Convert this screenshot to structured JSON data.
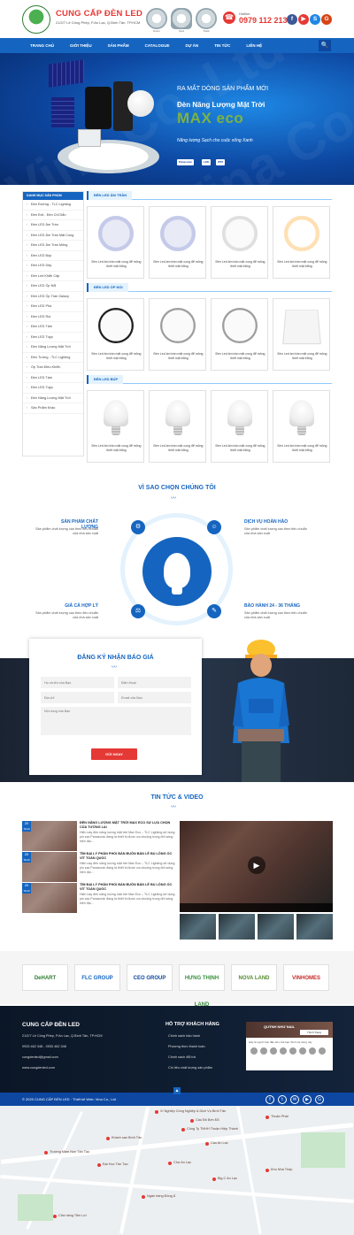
{
  "header": {
    "brand": "CUNG CẤP ĐÈN LED",
    "address": "21/2/7 Lê Công Phép, P.An Lạc, Q.Bình Tân, TP.HCM",
    "bulbs": [
      "Down",
      "Spot",
      "Track"
    ],
    "hotline_label": "Hotline",
    "hotline": "0979 112 213",
    "social": [
      {
        "name": "facebook-icon",
        "glyph": "f",
        "color": "#3b5998"
      },
      {
        "name": "youtube-icon",
        "glyph": "▶",
        "color": "#e53935"
      },
      {
        "name": "skype-icon",
        "glyph": "S",
        "color": "#1e88e5"
      },
      {
        "name": "google-plus-icon",
        "glyph": "G",
        "color": "#d84315"
      }
    ]
  },
  "nav": {
    "items": [
      "TRANG CHỦ",
      "GIỚI THIỆU",
      "SẢN PHẨM",
      "CATALOGUE",
      "DỰ ÁN",
      "TIN TỨC",
      "LIÊN HỆ"
    ],
    "search_icon": "🔍"
  },
  "banner": {
    "subtitle": "RA MẮT DÒNG SẢN PHẨM MỚI",
    "title": "Đèn Năng Lượng Mặt Trời",
    "product": "MAX eco",
    "slogan": "Năng lượng Sạch cho cuộc sống Xanh",
    "badges": [
      "Panasonic",
      "LED",
      "IP67"
    ],
    "watermark": "Vina Co.,Ltd"
  },
  "sidebar": {
    "title": "DANH MỤC SẢN PHẨM",
    "items": [
      "Đèn Đường - TLC Lighting",
      "Đèn Exit - Đèn Chỉ Dẫn",
      "Đèn LED Âm Trần",
      "Đèn LED Âm Trần Mặt Cong",
      "Đèn LED Âm Trần Mỏng",
      "Đèn LED Búp",
      "Đèn LED Dây",
      "Đèn Led Khẩn Cấp",
      "Đèn LED Ốp Nổi",
      "Đèn LED Ốp Trần Galaxy",
      "Đèn LED Pha",
      "Đèn LED Rọi",
      "Đèn LED Tấm",
      "Đèn LED Tuýp",
      "Đèn Năng Lượng Mặt Trời",
      "Đèn Tường - TLC Lighting",
      "Ổp Trần Điều Khiển",
      "Đèn LED Tấm",
      "Đèn LED Tuýp",
      "Đèn Năng Lượng Mặt Trời",
      "Sản Phẩm Khác"
    ]
  },
  "products": {
    "sections": [
      {
        "title": "ĐÈN LED ÂM TRẦN",
        "items": [
          {
            "caption": "Đèn Led âm trần mặt cong để mỏng thiết mặt trắng",
            "img": "i-down"
          },
          {
            "caption": "Đèn Led âm trần mặt cong để mỏng thiết mặt trắng",
            "img": "i-down"
          },
          {
            "caption": "Đèn Led âm trần mặt cong để mỏng thiết mặt trắng",
            "img": "i-down2"
          },
          {
            "caption": "Đèn Led âm trần mặt cong để mỏng thiết mặt trắng",
            "img": "i-down3"
          }
        ]
      },
      {
        "title": "ĐÈN LED ỐP NỔI",
        "items": [
          {
            "caption": "Đèn Led âm trần mặt cong để mỏng thiết mặt trắng",
            "img": "i-round-b"
          },
          {
            "caption": "Đèn Led âm trần mặt cong để mỏng thiết mặt trắng",
            "img": "i-round-g"
          },
          {
            "caption": "Đèn Led âm trần mặt cong để mỏng thiết mặt trắng",
            "img": "i-round-g"
          },
          {
            "caption": "Đèn Led âm trần mặt cong để mỏng thiết mặt trắng",
            "img": "i-sq"
          }
        ]
      },
      {
        "title": "ĐÈN LED BÚP",
        "items": [
          {
            "caption": "Đèn Led âm trần mặt cong để mỏng thiết mặt trắng",
            "img": "i-bulb"
          },
          {
            "caption": "Đèn Led âm trần mặt cong để mỏng thiết mặt trắng",
            "img": "i-bulb"
          },
          {
            "caption": "Đèn Led âm trần mặt cong để mỏng thiết mặt trắng",
            "img": "i-bulb"
          },
          {
            "caption": "Đèn Led âm trần mặt cong để mỏng thiết mặt trắng",
            "img": "i-bulb"
          }
        ]
      }
    ]
  },
  "why": {
    "title": "VÌ SAO CHỌN CHÚNG TÔI",
    "wave": "〰",
    "items": [
      {
        "heading": "SẢN PHẨM CHẤT LƯỢNG",
        "desc": "Sản phẩm chất lượng cao theo tiêu chuẩn của nhà sản xuất",
        "icon": "⚙"
      },
      {
        "heading": "DỊCH VỤ HOÀN HẢO",
        "desc": "Sản phẩm chất lượng cao theo tiêu chuẩn của nhà sản xuất",
        "icon": "☺"
      },
      {
        "heading": "GIÁ CẢ HỢP LÝ",
        "desc": "Sản phẩm chất lượng cao theo tiêu chuẩn của nhà sản xuất",
        "icon": "⚖"
      },
      {
        "heading": "BẢO HÀNH 24 - 36 THÁNG",
        "desc": "Sản phẩm chất lượng cao theo tiêu chuẩn của nhà sản xuất",
        "icon": "✎"
      }
    ]
  },
  "register": {
    "title": "ĐĂNG KÝ NHẬN BÁO GIÁ",
    "wave": "〰",
    "name_ph": "Họ và tên của Bạn",
    "phone_ph": "Điện thoại",
    "address_ph": "Địa chỉ",
    "email_ph": "Email của Bạn",
    "note_ph": "Nội dung của Bạn",
    "submit": "GỬI NGAY"
  },
  "news": {
    "title": "TIN TỨC & VIDEO",
    "wave": "〰",
    "items": [
      {
        "day": "20",
        "month": "TH10",
        "title": "ĐÈN NĂNG LƯỢNG MẶT TRỜI MAX ECO SỰ LỰA CHỌN CỦA TƯƠNG LAI",
        "desc": "Hiện nay đèn năng lượng mặt trời Max Eco – TLC Lighting sử dụng pin sạc Panasonic đang là thiết bị được ưa chuộng trong đời sống hiện đại..."
      },
      {
        "day": "20",
        "month": "TH10",
        "title": "TÌM ĐẠI LÝ PHÂN PHỐI BÁN BUÔN BÁN LẺ BU LÔNG ỐC VÍT TOÀN QUỐC",
        "desc": "Hiện nay đèn năng lượng mặt trời Max Eco – TLC Lighting sử dụng pin sạc Panasonic đang là thiết bị được ưa chuộng trong đời sống hiện đại..."
      },
      {
        "day": "20",
        "month": "TH10",
        "title": "TÌM ĐẠI LÝ PHÂN PHỐI BÁN BUÔN BÁN LẺ BU LÔNG ỐC VÍT TOÀN QUỐC",
        "desc": "Hiện nay đèn năng lượng mặt trời Max Eco – TLC Lighting sử dụng pin sạc Panasonic đang là thiết bị được ưa chuộng trong đời sống hiện đại..."
      }
    ],
    "play_icon": "▶"
  },
  "partners": [
    "DeHART",
    "FLC GROUP",
    "CEO GROUP",
    "HƯNG THỊNH LAND",
    "NOVA LAND",
    "VINHOMES"
  ],
  "partner_colors": [
    "#2e7d32",
    "#1565c0",
    "#0d47a1",
    "#388e3c",
    "#558b2f",
    "#c62828"
  ],
  "footer": {
    "brand": "CUNG CẤP ĐÈN LED",
    "address": "21/2/7 Lê Công Phép, P.An Lạc, Q.Bình Tân, TP.HCM",
    "phone": "0933 462 348 - 0933 462 348",
    "email": "congdenled@gmail.com",
    "web": "www.cungdenled.com",
    "cs_title": "HỖ TRỢ KHÁCH HÀNG",
    "cs_links": [
      "Chính sách bảo hành",
      "Phương thức thanh toán",
      "Chính sách đổi trả",
      "Chi tiêu chất lượng sản phẩm"
    ],
    "fb_name": "QUỲNH NHƯ NAIL",
    "fb_like": "Thích Trang",
    "fb_text": "Hãy là người bạn đầu tiên của bạn thích nội dung này"
  },
  "bottom": {
    "copyright": "© 2020 CUNG CẤP ĐÈN LED  ·  Thiết kế Web: Vina Co., Ltd",
    "social": [
      "f",
      "t",
      "✉",
      "▶",
      "G"
    ]
  },
  "map": {
    "pois": [
      "Xí Nghiệp Công Nghiệp & Dịch Vụ Bình Tân",
      "Cầu Đỏ Bến Đỗ",
      "Thuận Phát",
      "Công Ty TNHH Thuận Hiệp Thành",
      "Khách sạn Bình Tân",
      "Cầu An Lạc",
      "Trường Mầm Non Tân Tạo",
      "Đại Học Tân Tạo",
      "Chợ An Lạc",
      "Kho Nhà Thép",
      "Big C An Lạc",
      "Ngân hàng Đông Á",
      "Cửa hàng Tiện Lợi"
    ]
  }
}
